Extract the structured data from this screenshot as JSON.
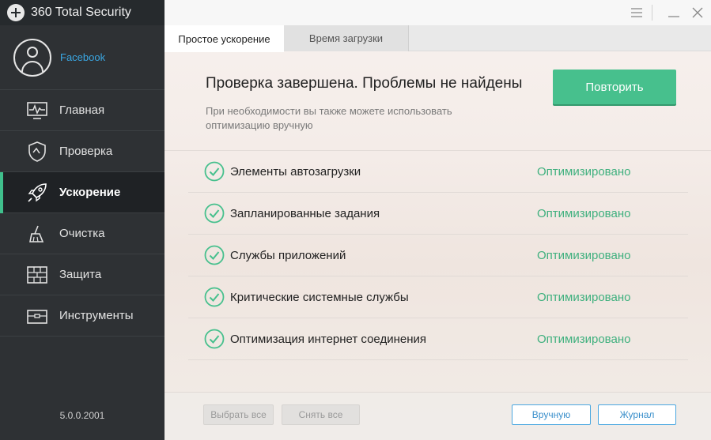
{
  "app": {
    "title": "360 Total Security",
    "version": "5.0.0.2001"
  },
  "profile": {
    "name": "Facebook"
  },
  "sidebar": {
    "items": [
      {
        "label": "Главная",
        "icon": "pulse-monitor-icon"
      },
      {
        "label": "Проверка",
        "icon": "shield-icon"
      },
      {
        "label": "Ускорение",
        "icon": "rocket-icon",
        "active": true
      },
      {
        "label": "Очистка",
        "icon": "broom-icon"
      },
      {
        "label": "Защита",
        "icon": "brick-wall-icon"
      },
      {
        "label": "Инструменты",
        "icon": "toolbox-icon"
      }
    ]
  },
  "tabs": [
    {
      "label": "Простое ускорение",
      "active": true
    },
    {
      "label": "Время загрузки",
      "active": false
    }
  ],
  "result": {
    "title": "Проверка завершена. Проблемы не найдены",
    "subtitle": "При необходимости вы также можете использовать оптимизацию вручную",
    "retry_label": "Повторить"
  },
  "items": [
    {
      "label": "Элементы автозагрузки",
      "status": "Оптимизировано"
    },
    {
      "label": "Запланированные задания",
      "status": "Оптимизировано"
    },
    {
      "label": "Службы приложений",
      "status": "Оптимизировано"
    },
    {
      "label": "Критические системные службы",
      "status": "Оптимизировано"
    },
    {
      "label": "Оптимизация интернет соединения",
      "status": "Оптимизировано"
    }
  ],
  "footer": {
    "select_all": "Выбрать все",
    "deselect_all": "Снять все",
    "manual": "Вручную",
    "journal": "Журнал"
  },
  "colors": {
    "accent": "#47c08d",
    "status": "#3fb07e",
    "link": "#3aa7e3",
    "sidebar_bg": "#2e3134"
  }
}
